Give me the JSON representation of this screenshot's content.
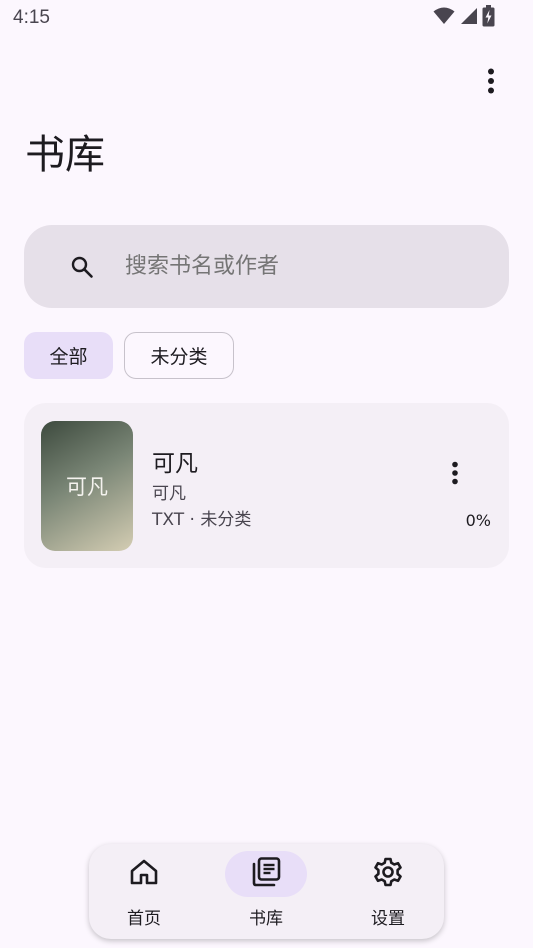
{
  "status_bar": {
    "time": "4:15",
    "icons": [
      "wifi-icon",
      "signal-icon",
      "battery-charging-icon"
    ]
  },
  "header": {
    "title": "书库",
    "more_icon": "more-vert-icon"
  },
  "search": {
    "placeholder": "搜索书名或作者",
    "icon": "search-icon"
  },
  "filters": [
    {
      "label": "全部",
      "selected": true
    },
    {
      "label": "未分类",
      "selected": false
    }
  ],
  "books": [
    {
      "cover_text": "可凡",
      "title": "可凡",
      "author": "可凡",
      "meta": "TXT · 未分类",
      "progress": "0%"
    }
  ],
  "bottom_nav": [
    {
      "label": "首页",
      "icon": "home-icon",
      "active": false
    },
    {
      "label": "书库",
      "icon": "library-icon",
      "active": true
    },
    {
      "label": "设置",
      "icon": "gear-icon",
      "active": false
    }
  ],
  "colors": {
    "background": "#fcf7fe",
    "search_bg": "#e6e0e9",
    "selected_chip": "#e8def8",
    "card_bg": "#f4eff6"
  }
}
